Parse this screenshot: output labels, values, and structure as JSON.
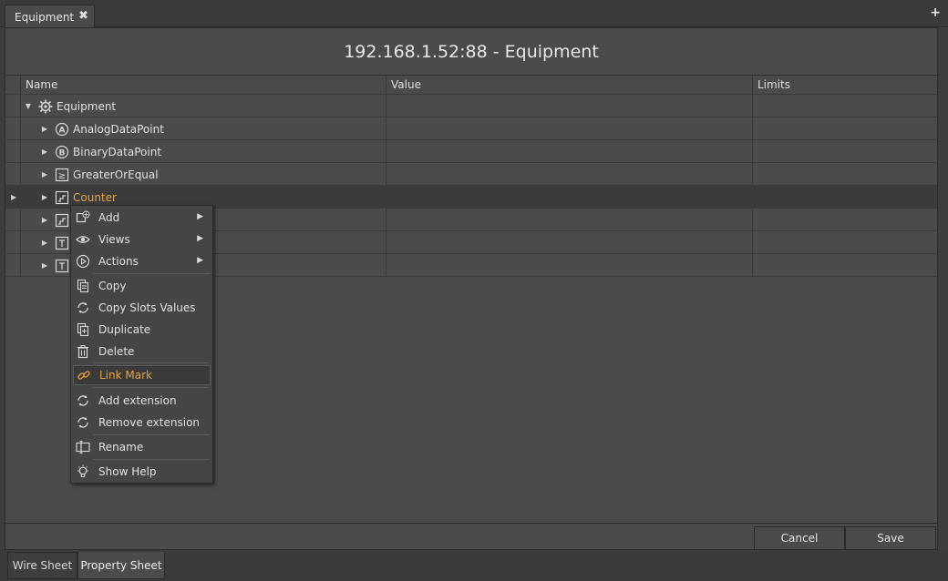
{
  "tab": {
    "title": "Equipment",
    "close_glyph": "✖",
    "add_glyph": "+"
  },
  "panel": {
    "title": "192.168.1.52:88 - Equipment"
  },
  "columns": {
    "name": "Name",
    "value": "Value",
    "limits": "Limits"
  },
  "tree": [
    {
      "label": "Equipment",
      "icon": "gear-icon",
      "expanded": true,
      "selected": false
    },
    {
      "label": "AnalogDataPoint",
      "icon": "analog-point-icon",
      "expanded": false,
      "selected": false
    },
    {
      "label": "BinaryDataPoint",
      "icon": "binary-point-icon",
      "expanded": false,
      "selected": false
    },
    {
      "label": "GreaterOrEqual",
      "icon": "greater-equal-icon",
      "expanded": false,
      "selected": false
    },
    {
      "label": "Counter",
      "icon": "counter-icon",
      "expanded": false,
      "selected": true
    },
    {
      "label": "",
      "icon": "counter-icon",
      "expanded": false,
      "selected": false
    },
    {
      "label": "",
      "icon": "block-icon",
      "expanded": false,
      "selected": false
    },
    {
      "label": "",
      "icon": "block-icon",
      "expanded": false,
      "selected": false
    }
  ],
  "context_menu": {
    "items": [
      {
        "label": "Add",
        "icon": "add-icon",
        "submenu": true
      },
      {
        "label": "Views",
        "icon": "eye-icon",
        "submenu": true
      },
      {
        "label": "Actions",
        "icon": "play-circle-icon",
        "submenu": true
      },
      {
        "label": "Copy",
        "icon": "copy-icon",
        "submenu": false
      },
      {
        "label": "Copy Slots Values",
        "icon": "refresh-icon",
        "submenu": false
      },
      {
        "label": "Duplicate",
        "icon": "duplicate-icon",
        "submenu": false
      },
      {
        "label": "Delete",
        "icon": "trash-icon",
        "submenu": false
      },
      {
        "label": "Link Mark",
        "icon": "link-icon",
        "submenu": false,
        "hover": true
      },
      {
        "label": "Add extension",
        "icon": "refresh-icon",
        "submenu": false
      },
      {
        "label": "Remove extension",
        "icon": "refresh-icon",
        "submenu": false
      },
      {
        "label": "Rename",
        "icon": "rename-icon",
        "submenu": false
      },
      {
        "label": "Show Help",
        "icon": "lightbulb-icon",
        "submenu": false
      }
    ]
  },
  "buttons": {
    "cancel": "Cancel",
    "save": "Save"
  },
  "bottom_tabs": [
    {
      "label": "Wire Sheet",
      "active": false
    },
    {
      "label": "Property Sheet",
      "active": true
    }
  ],
  "colors": {
    "accent": "#e8a23a",
    "background": "#4b4b4b",
    "selected_row": "#3b3b3b"
  }
}
